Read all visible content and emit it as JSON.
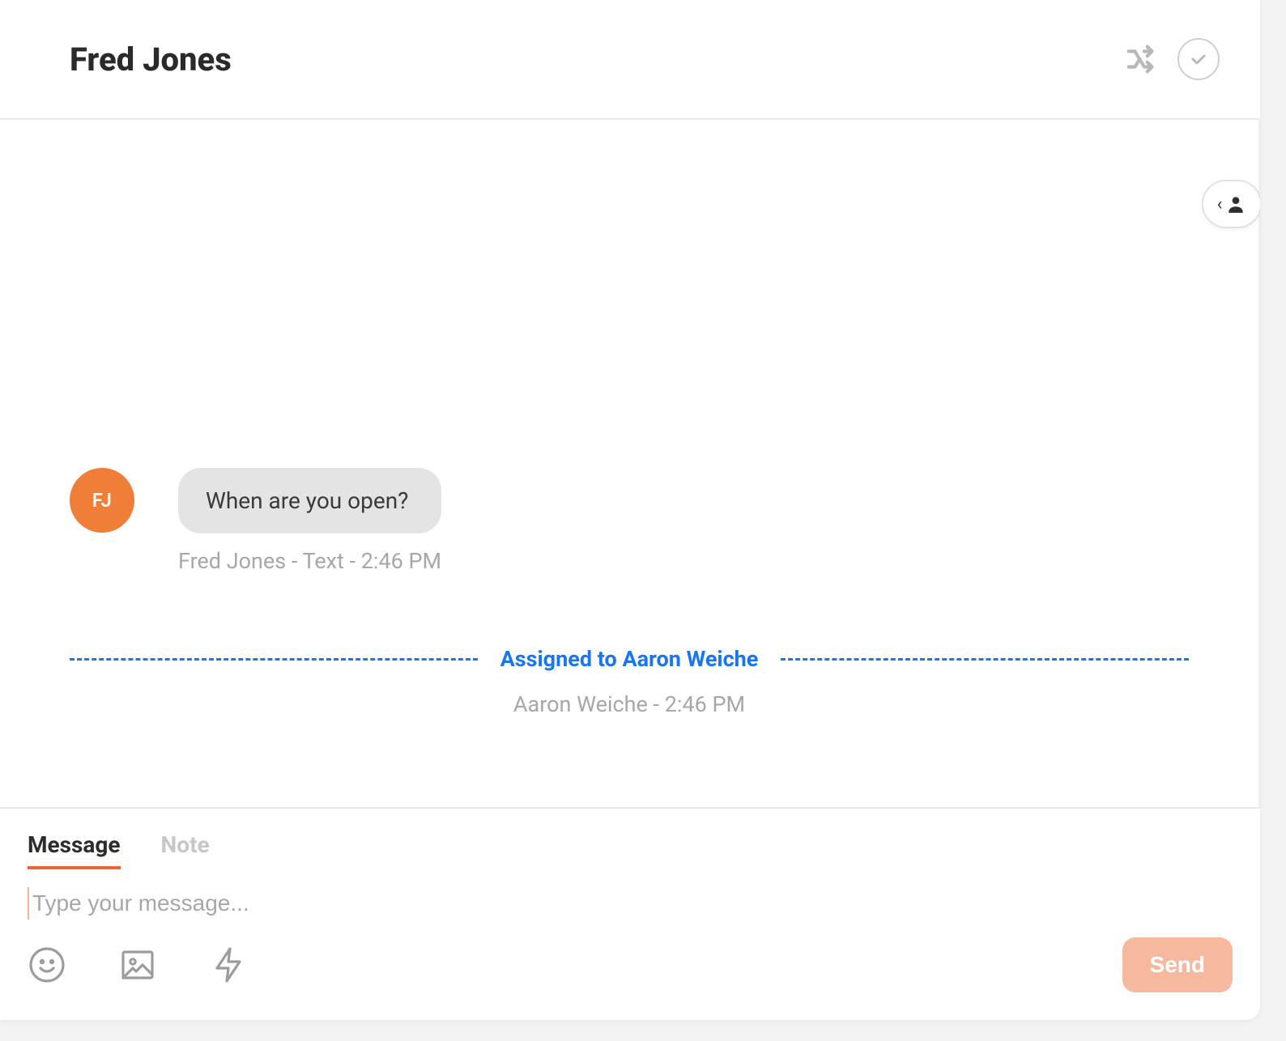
{
  "header": {
    "title": "Fred Jones"
  },
  "conversation": {
    "avatar_initials": "FJ",
    "bubble_text": "When are you open?",
    "meta": "Fred Jones - Text - 2:46 PM",
    "assignment_text": "Assigned to Aaron Weiche",
    "assignment_meta": "Aaron Weiche - 2:46 PM"
  },
  "composer": {
    "tabs": {
      "message": "Message",
      "note": "Note"
    },
    "placeholder": "Type your message...",
    "send_label": "Send"
  },
  "colors": {
    "accent_orange": "#ed6238",
    "avatar_orange": "#f07e39",
    "link_blue": "#1976ef",
    "muted": "#a7a7aa",
    "bubble_gray": "#e4e4e5",
    "send_disabled": "#f6b99e"
  }
}
